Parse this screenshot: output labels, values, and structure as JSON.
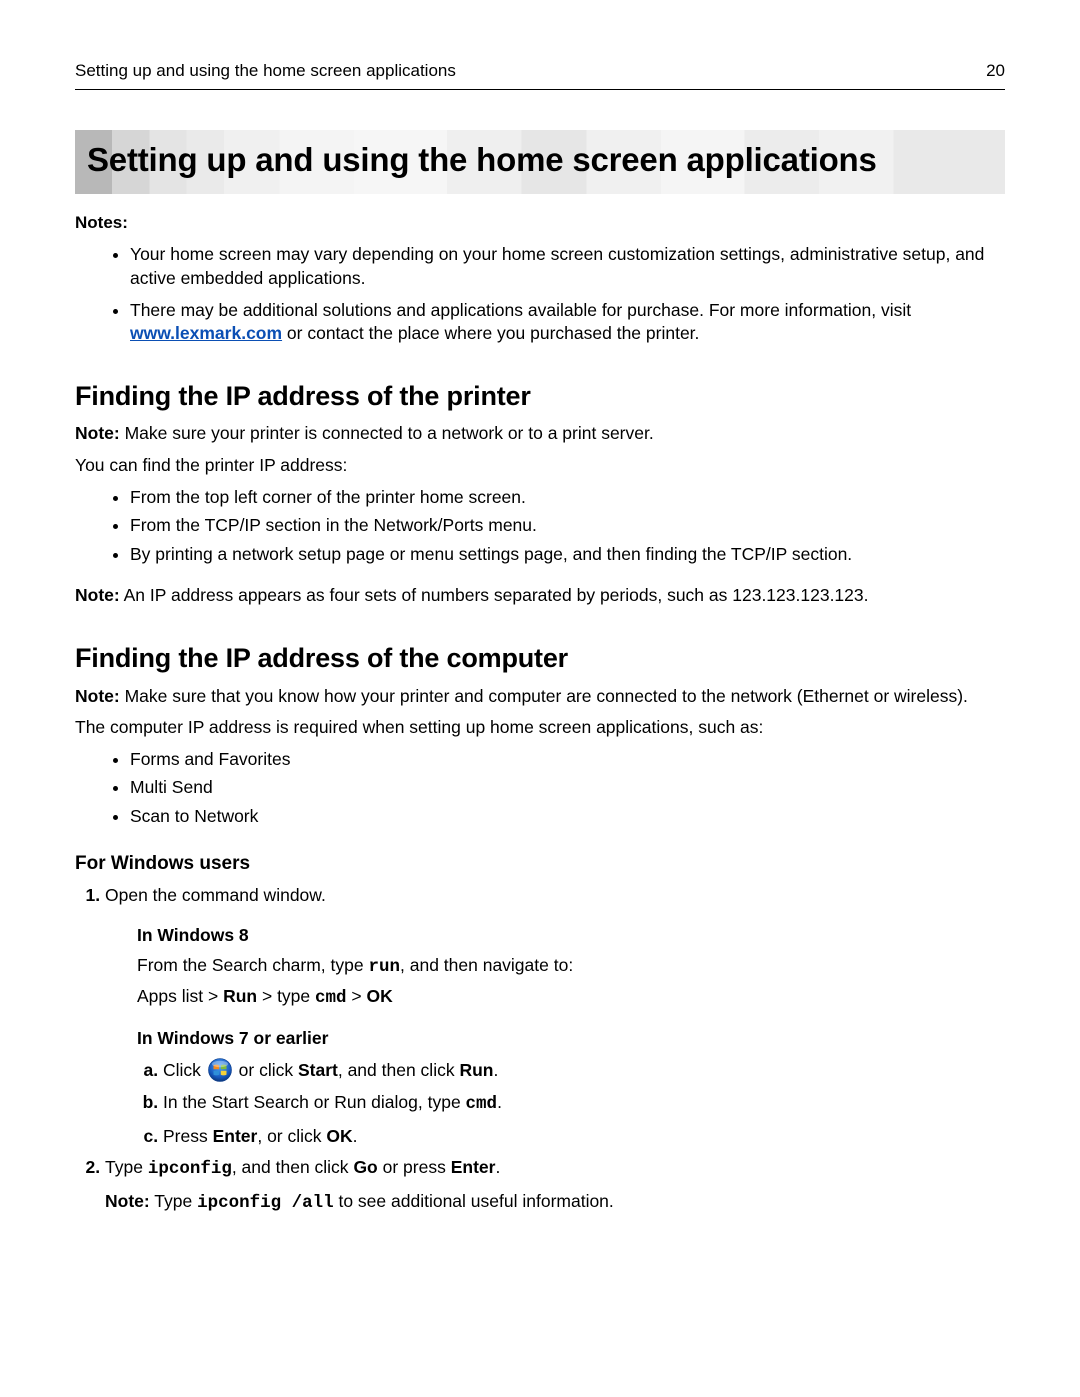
{
  "header": {
    "running_title": "Setting up and using the home screen applications",
    "page_number": "20"
  },
  "title": "Setting up and using the home screen applications",
  "notes_label": "Notes:",
  "notes": {
    "item1": "Your home screen may vary depending on your home screen customization settings, administrative setup, and active embedded applications.",
    "item2_pre": "There may be additional solutions and applications available for purchase. For more information, visit ",
    "item2_link": "www.lexmark.com",
    "item2_post": " or contact the place where you purchased the printer."
  },
  "s1": {
    "heading": "Finding the IP address of the printer",
    "note_label": "Note:",
    "note_text": " Make sure your printer is connected to a network or to a print server.",
    "lead": "You can find the printer IP address:",
    "b1": "From the top left corner of the printer home screen.",
    "b2": "From the TCP/IP section in the Network/Ports menu.",
    "b3": "By printing a network setup page or menu settings page, and then finding the TCP/IP section.",
    "note2_label": "Note:",
    "note2_text": " An IP address appears as four sets of numbers separated by periods, such as 123.123.123.123."
  },
  "s2": {
    "heading": "Finding the IP address of the computer",
    "note_label": "Note:",
    "note_text": " Make sure that you know how your printer and computer are connected to the network (Ethernet or wireless).",
    "lead": "The computer IP address is required when setting up home screen applications, such as:",
    "b1": "Forms and Favorites",
    "b2": "Multi Send",
    "b3": "Scan to Network",
    "win_heading": "For Windows users",
    "step1": "Open the command window.",
    "win8_heading": "In Windows 8",
    "win8_l1_a": "From the Search charm, type ",
    "win8_l1_run": "run",
    "win8_l1_b": ", and then navigate to:",
    "win8_l2_a": "Apps list > ",
    "win8_l2_run": "Run",
    "win8_l2_b": " > type ",
    "win8_l2_cmd": "cmd",
    "win8_l2_c": " > ",
    "win8_l2_ok": "OK",
    "win7_heading": "In Windows 7 or earlier",
    "win7_a_1": "Click ",
    "win7_a_2": " or click ",
    "win7_a_start": "Start",
    "win7_a_3": ", and then click ",
    "win7_a_run": "Run",
    "win7_a_4": ".",
    "win7_b_1": "In the Start Search or Run dialog, type ",
    "win7_b_cmd": "cmd",
    "win7_b_2": ".",
    "win7_c_1": "Press ",
    "win7_c_enter": "Enter",
    "win7_c_2": ", or click ",
    "win7_c_ok": "OK",
    "win7_c_3": ".",
    "step2_a": "Type ",
    "step2_cmd": "ipconfig",
    "step2_b": ", and then click ",
    "step2_go": "Go",
    "step2_c": " or press ",
    "step2_enter": "Enter",
    "step2_d": ".",
    "step2_note_label": "Note:",
    "step2_note_a": " Type ",
    "step2_note_cmd": "ipconfig /all",
    "step2_note_b": " to see additional useful information."
  }
}
